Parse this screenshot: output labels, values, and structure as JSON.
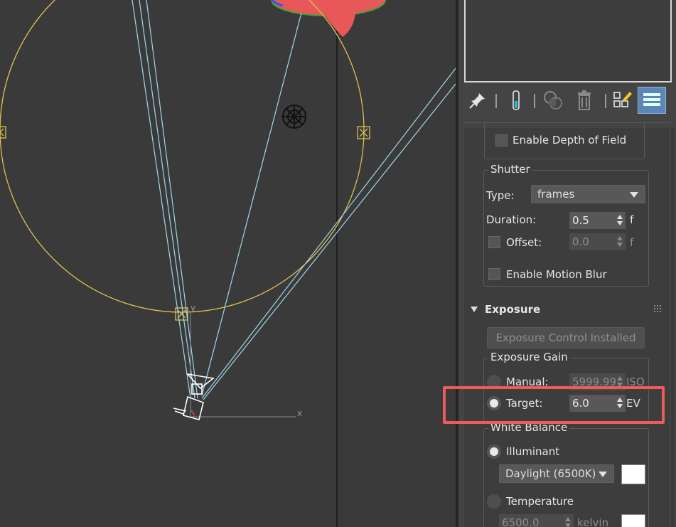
{
  "viewport": {
    "axis_y_label": "y",
    "axis_x_label": "x",
    "colors": {
      "background": "#3a3a3a",
      "focus_circle": "#e0c050",
      "camera_rays": "#9fd8ec",
      "object": "#e85858"
    }
  },
  "toolbar": {
    "icons": [
      "pin-stack-icon",
      "modifier-stack-bar-icon",
      "make-unique-icon",
      "remove-modifier-icon",
      "configure-modifier-sets-icon",
      "show-end-result-icon"
    ]
  },
  "depth_of_field": {
    "checkbox_label": "Enable Depth of Field",
    "checked": false
  },
  "shutter": {
    "title": "Shutter",
    "type_label": "Type:",
    "type_value": "frames",
    "duration_label": "Duration:",
    "duration_value": "0.5",
    "duration_unit": "f",
    "offset_label": "Offset:",
    "offset_value": "0.0",
    "offset_unit": "f",
    "offset_checked": false,
    "motion_blur_label": "Enable Motion Blur",
    "motion_blur_checked": false
  },
  "exposure": {
    "rollout_title": "Exposure",
    "installed_button": "Exposure Control Installed",
    "gain_title": "Exposure Gain",
    "manual_label": "Manual:",
    "manual_value": "5999.99",
    "manual_unit": "ISO",
    "target_label": "Target:",
    "target_value": "6.0",
    "target_unit": "EV",
    "selected": "target"
  },
  "white_balance": {
    "title": "White Balance",
    "illuminant_label": "Illuminant",
    "illuminant_value": "Daylight (6500K)",
    "temperature_label": "Temperature",
    "temperature_value": "6500.0",
    "temperature_unit": "kelvin",
    "selected": "illuminant",
    "swatch_color": "#ffffff"
  },
  "highlight_color": "#ee5b5b"
}
